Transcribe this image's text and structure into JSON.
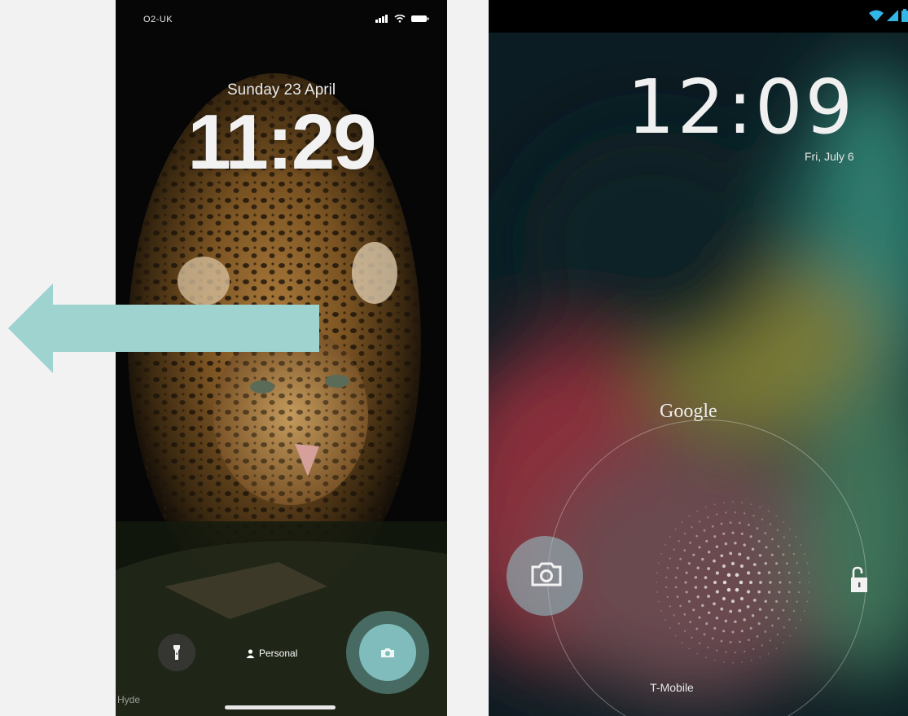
{
  "ios_lockscreen": {
    "carrier": "O2-UK",
    "date": "Sunday 23 April",
    "time": "11:29",
    "focus_mode_label": "Personal",
    "photo_credit": "Hyde",
    "icons": [
      "signal-icon",
      "wifi-icon",
      "battery-icon",
      "flashlight-icon",
      "person-icon",
      "camera-icon"
    ]
  },
  "android_lockscreen": {
    "time": "12:09",
    "date": "Fri, July 6",
    "brand_label": "Google",
    "carrier": "T-Mobile",
    "icons": [
      "wifi-icon",
      "signal-icon",
      "battery-icon",
      "camera-icon",
      "unlock-icon"
    ]
  },
  "arrow": {
    "direction": "left",
    "color": "#9ed3cf"
  },
  "colors": {
    "camera_accent": "#7fbcbb",
    "page_background": "#f2f2f2"
  }
}
